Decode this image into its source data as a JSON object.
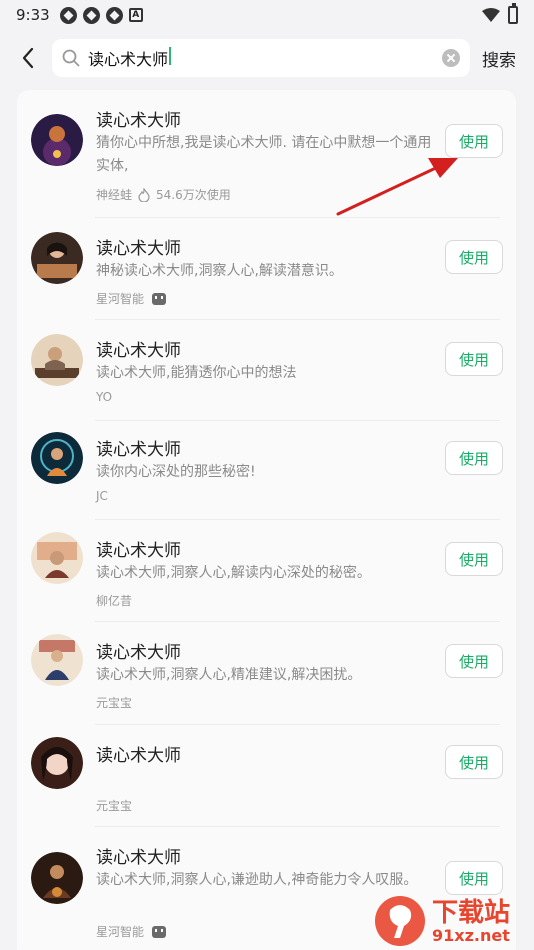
{
  "status_bar": {
    "time": "9:33",
    "notification_icon_letter": "A"
  },
  "search": {
    "query": "读心术大师",
    "search_button": "搜索"
  },
  "items": [
    {
      "title": "读心术大师",
      "description": "猜你心中所想,我是读心术大师. 请在心中默想一个通用实体,",
      "author": "神经蛙",
      "uses": "54.6万次使用",
      "button": "使用",
      "avatar_colors": [
        "#2a1b45",
        "#c9743b"
      ]
    },
    {
      "title": "读心术大师",
      "description": "神秘读心术大师,洞察人心,解读潜意识。",
      "author": "星河智能",
      "uses": "",
      "button": "使用",
      "avatar_colors": [
        "#3b2a22",
        "#b97a4c"
      ]
    },
    {
      "title": "读心术大师",
      "description": "读心术大师,能猜透你心中的想法",
      "author": "YO",
      "uses": "",
      "button": "使用",
      "avatar_colors": [
        "#e6d3bc",
        "#5a3f2c"
      ]
    },
    {
      "title": "读心术大师",
      "description": "读你内心深处的那些秘密!",
      "author": "JC",
      "uses": "",
      "button": "使用",
      "avatar_colors": [
        "#0d2a3a",
        "#e28a3a"
      ]
    },
    {
      "title": "读心术大师",
      "description": "读心术大师,洞察人心,解读内心深处的秘密。",
      "author": "柳亿昔",
      "uses": "",
      "button": "使用",
      "avatar_colors": [
        "#f0e1cf",
        "#7a3b2e"
      ]
    },
    {
      "title": "读心术大师",
      "description": "读心术大师,洞察人心,精准建议,解决困扰。",
      "author": "元宝宝",
      "uses": "",
      "button": "使用",
      "avatar_colors": [
        "#efe2d1",
        "#8a2f2f"
      ]
    },
    {
      "title": "读心术大师",
      "description": "",
      "author": "元宝宝",
      "uses": "",
      "button": "使用",
      "avatar_colors": [
        "#f2d5c7",
        "#3a1f18"
      ]
    },
    {
      "title": "读心术大师",
      "description": "读心术大师,洞察人心,谦逊助人,神奇能力令人叹服。",
      "author": "星河智能",
      "uses": "",
      "button": "使用",
      "avatar_colors": [
        "#2a1a12",
        "#d58a3a"
      ]
    }
  ],
  "watermark": {
    "logo_text": "下载站",
    "url_text": "91xz.net"
  },
  "colors": {
    "accent": "#1aab67",
    "arrow": "#d41f1f"
  }
}
